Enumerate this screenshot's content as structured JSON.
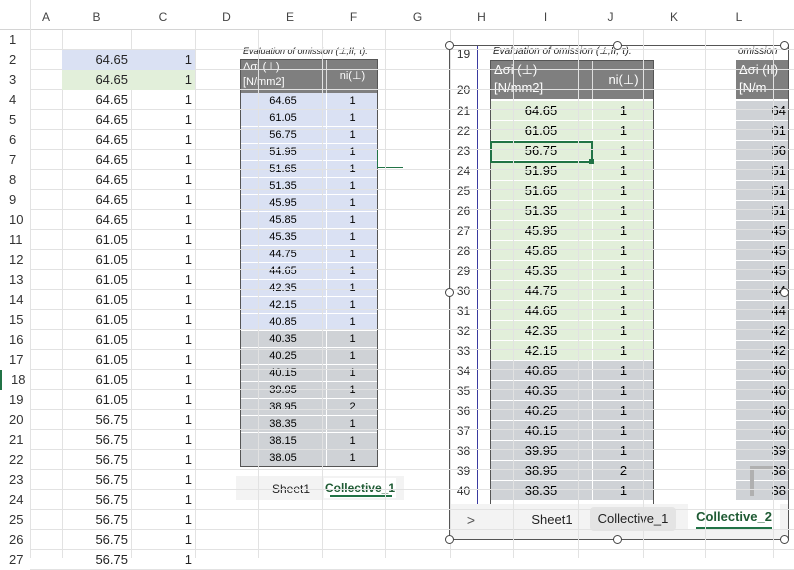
{
  "columns_main": [
    "A",
    "B",
    "C",
    "D",
    "E",
    "F",
    "G",
    "H",
    "I",
    "J",
    "K",
    "L"
  ],
  "main_rows": [
    {
      "r": "1",
      "b": "",
      "c": ""
    },
    {
      "r": "2",
      "b": "64.65",
      "c": "1"
    },
    {
      "r": "3",
      "b": "64.65",
      "c": "1"
    },
    {
      "r": "4",
      "b": "64.65",
      "c": "1"
    },
    {
      "r": "5",
      "b": "64.65",
      "c": "1"
    },
    {
      "r": "6",
      "b": "64.65",
      "c": "1"
    },
    {
      "r": "7",
      "b": "64.65",
      "c": "1"
    },
    {
      "r": "8",
      "b": "64.65",
      "c": "1"
    },
    {
      "r": "9",
      "b": "64.65",
      "c": "1"
    },
    {
      "r": "10",
      "b": "64.65",
      "c": "1"
    },
    {
      "r": "11",
      "b": "61.05",
      "c": "1"
    },
    {
      "r": "12",
      "b": "61.05",
      "c": "1"
    },
    {
      "r": "13",
      "b": "61.05",
      "c": "1"
    },
    {
      "r": "14",
      "b": "61.05",
      "c": "1"
    },
    {
      "r": "15",
      "b": "61.05",
      "c": "1"
    },
    {
      "r": "16",
      "b": "61.05",
      "c": "1"
    },
    {
      "r": "17",
      "b": "61.05",
      "c": "1"
    },
    {
      "r": "18",
      "b": "61.05",
      "c": "1"
    },
    {
      "r": "19",
      "b": "61.05",
      "c": "1"
    },
    {
      "r": "20",
      "b": "56.75",
      "c": "1"
    },
    {
      "r": "21",
      "b": "56.75",
      "c": "1"
    },
    {
      "r": "22",
      "b": "56.75",
      "c": "1"
    },
    {
      "r": "23",
      "b": "56.75",
      "c": "1"
    },
    {
      "r": "24",
      "b": "56.75",
      "c": "1"
    },
    {
      "r": "25",
      "b": "56.75",
      "c": "1"
    },
    {
      "r": "26",
      "b": "56.75",
      "c": "1"
    },
    {
      "r": "27",
      "b": "56.75",
      "c": "1"
    }
  ],
  "embed1": {
    "caption": "Evaluation of omission  (⊥,II, τ).",
    "hdr_col1": "Δσi (⊥)\n[N/mm2]",
    "hdr_col2": "ni(⊥)",
    "rows": [
      {
        "v": "64.65",
        "n": "1",
        "g": false
      },
      {
        "v": "61.05",
        "n": "1",
        "g": false
      },
      {
        "v": "56.75",
        "n": "1",
        "g": false
      },
      {
        "v": "51.95",
        "n": "1",
        "g": false
      },
      {
        "v": "51.65",
        "n": "1",
        "g": false
      },
      {
        "v": "51.35",
        "n": "1",
        "g": false
      },
      {
        "v": "45.95",
        "n": "1",
        "g": false
      },
      {
        "v": "45.85",
        "n": "1",
        "g": false
      },
      {
        "v": "45.35",
        "n": "1",
        "g": false
      },
      {
        "v": "44.75",
        "n": "1",
        "g": false
      },
      {
        "v": "44.65",
        "n": "1",
        "g": false
      },
      {
        "v": "42.35",
        "n": "1",
        "g": false
      },
      {
        "v": "42.15",
        "n": "1",
        "g": false
      },
      {
        "v": "40.85",
        "n": "1",
        "g": false
      },
      {
        "v": "40.35",
        "n": "1",
        "g": true
      },
      {
        "v": "40.25",
        "n": "1",
        "g": true
      },
      {
        "v": "40.15",
        "n": "1",
        "g": true
      },
      {
        "v": "39.95",
        "n": "1",
        "g": true
      },
      {
        "v": "38.95",
        "n": "2",
        "g": true
      },
      {
        "v": "38.35",
        "n": "1",
        "g": true
      },
      {
        "v": "38.15",
        "n": "1",
        "g": true
      },
      {
        "v": "38.05",
        "n": "1",
        "g": true
      }
    ],
    "tabs": [
      "Sheet1",
      "Collective_1"
    ]
  },
  "embed2": {
    "caption": "Evaluation of omission  (⊥,II, τ).",
    "caption_right": "omission",
    "hdr_col1": "Δσi (⊥)\n[N/mm2]",
    "hdr_col2": "ni(⊥)",
    "hdr_col3": "Δσi (II)\n[N/m",
    "rows": [
      {
        "r": "19",
        "v": "",
        "n": "",
        "l": "",
        "g": false
      },
      {
        "r": "20",
        "v": "",
        "n": "",
        "l": "",
        "g": false
      },
      {
        "r": "21",
        "v": "64.65",
        "n": "1",
        "l": "64",
        "g": false
      },
      {
        "r": "22",
        "v": "61.05",
        "n": "1",
        "l": "61",
        "g": false
      },
      {
        "r": "23",
        "v": "56.75",
        "n": "1",
        "l": "56",
        "g": false
      },
      {
        "r": "24",
        "v": "51.95",
        "n": "1",
        "l": "51",
        "g": false
      },
      {
        "r": "25",
        "v": "51.65",
        "n": "1",
        "l": "51",
        "g": false
      },
      {
        "r": "26",
        "v": "51.35",
        "n": "1",
        "l": "51",
        "g": false
      },
      {
        "r": "27",
        "v": "45.95",
        "n": "1",
        "l": "45",
        "g": false
      },
      {
        "r": "28",
        "v": "45.85",
        "n": "1",
        "l": "45",
        "g": false
      },
      {
        "r": "29",
        "v": "45.35",
        "n": "1",
        "l": "45",
        "g": false
      },
      {
        "r": "30",
        "v": "44.75",
        "n": "1",
        "l": "44",
        "g": false
      },
      {
        "r": "31",
        "v": "44.65",
        "n": "1",
        "l": "44",
        "g": false
      },
      {
        "r": "32",
        "v": "42.35",
        "n": "1",
        "l": "42",
        "g": false
      },
      {
        "r": "33",
        "v": "42.15",
        "n": "1",
        "l": "42",
        "g": false
      },
      {
        "r": "34",
        "v": "40.85",
        "n": "1",
        "l": "40",
        "g": true
      },
      {
        "r": "35",
        "v": "40.35",
        "n": "1",
        "l": "40",
        "g": true
      },
      {
        "r": "36",
        "v": "40.25",
        "n": "1",
        "l": "40",
        "g": true
      },
      {
        "r": "37",
        "v": "40.15",
        "n": "1",
        "l": "40",
        "g": true
      },
      {
        "r": "38",
        "v": "39.95",
        "n": "1",
        "l": "39",
        "g": true
      },
      {
        "r": "39",
        "v": "38.95",
        "n": "2",
        "l": "38",
        "g": true
      },
      {
        "r": "40",
        "v": "38.35",
        "n": "1",
        "l": "38",
        "g": true
      }
    ],
    "tabs": [
      "Sheet1",
      "Collective_1",
      "Collective_2"
    ],
    "nav_arrow": ">"
  },
  "colors": {
    "green_fill": "#e2efda",
    "blue_fill": "#dae1f3",
    "gray_fill": "#cfd2d6",
    "header_fill": "#7f7f7f",
    "accent": "#217346"
  }
}
